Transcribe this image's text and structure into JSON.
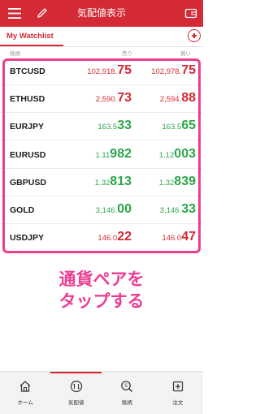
{
  "header": {
    "title": "気配値表示",
    "menu_icon": "hamburger-menu-icon",
    "edit_icon": "pencil-icon",
    "wallet_icon": "wallet-icon"
  },
  "tabs": {
    "active_label": "My Watchlist",
    "add_icon": "plus-circle-icon"
  },
  "columns": {
    "symbol": "銘柄",
    "sell": "売り",
    "buy": "買い"
  },
  "rows": [
    {
      "symbol": "BTCUSD",
      "sell": {
        "small": "102,918.",
        "big": "75",
        "color": "red"
      },
      "buy": {
        "small": "102,978.",
        "big": "75",
        "color": "red"
      }
    },
    {
      "symbol": "ETHUSD",
      "sell": {
        "small": "2,590.",
        "big": "73",
        "color": "red"
      },
      "buy": {
        "small": "2,594.",
        "big": "88",
        "color": "red"
      }
    },
    {
      "symbol": "EURJPY",
      "sell": {
        "small": "163.5",
        "big": "33",
        "color": "green"
      },
      "buy": {
        "small": "163.5",
        "big": "65",
        "color": "green"
      }
    },
    {
      "symbol": "EURUSD",
      "sell": {
        "small": "1.11",
        "big": "982",
        "color": "green"
      },
      "buy": {
        "small": "1.12",
        "big": "003",
        "color": "green"
      }
    },
    {
      "symbol": "GBPUSD",
      "sell": {
        "small": "1.32",
        "big": "813",
        "color": "green"
      },
      "buy": {
        "small": "1.32",
        "big": "839",
        "color": "green"
      }
    },
    {
      "symbol": "GOLD",
      "sell": {
        "small": "3,146.",
        "big": "00",
        "color": "green"
      },
      "buy": {
        "small": "3,146.",
        "big": "33",
        "color": "green"
      }
    },
    {
      "symbol": "USDJPY",
      "sell": {
        "small": "146.0",
        "big": "22",
        "color": "red"
      },
      "buy": {
        "small": "146.0",
        "big": "47",
        "color": "red"
      }
    }
  ],
  "annotation": {
    "line1": "通貨ペアを",
    "line2": "タップする"
  },
  "nav": [
    {
      "label": "ホーム",
      "icon": "home-icon",
      "active": false
    },
    {
      "label": "気配値",
      "icon": "quotes-icon",
      "active": true
    },
    {
      "label": "銘柄",
      "icon": "search-symbol-icon",
      "active": false
    },
    {
      "label": "注文",
      "icon": "order-icon",
      "active": false
    }
  ],
  "colors": {
    "brand_red": "#d42a35",
    "price_red": "#d42a35",
    "price_green": "#2ca54b",
    "highlight_pink": "#ec3e8d"
  }
}
